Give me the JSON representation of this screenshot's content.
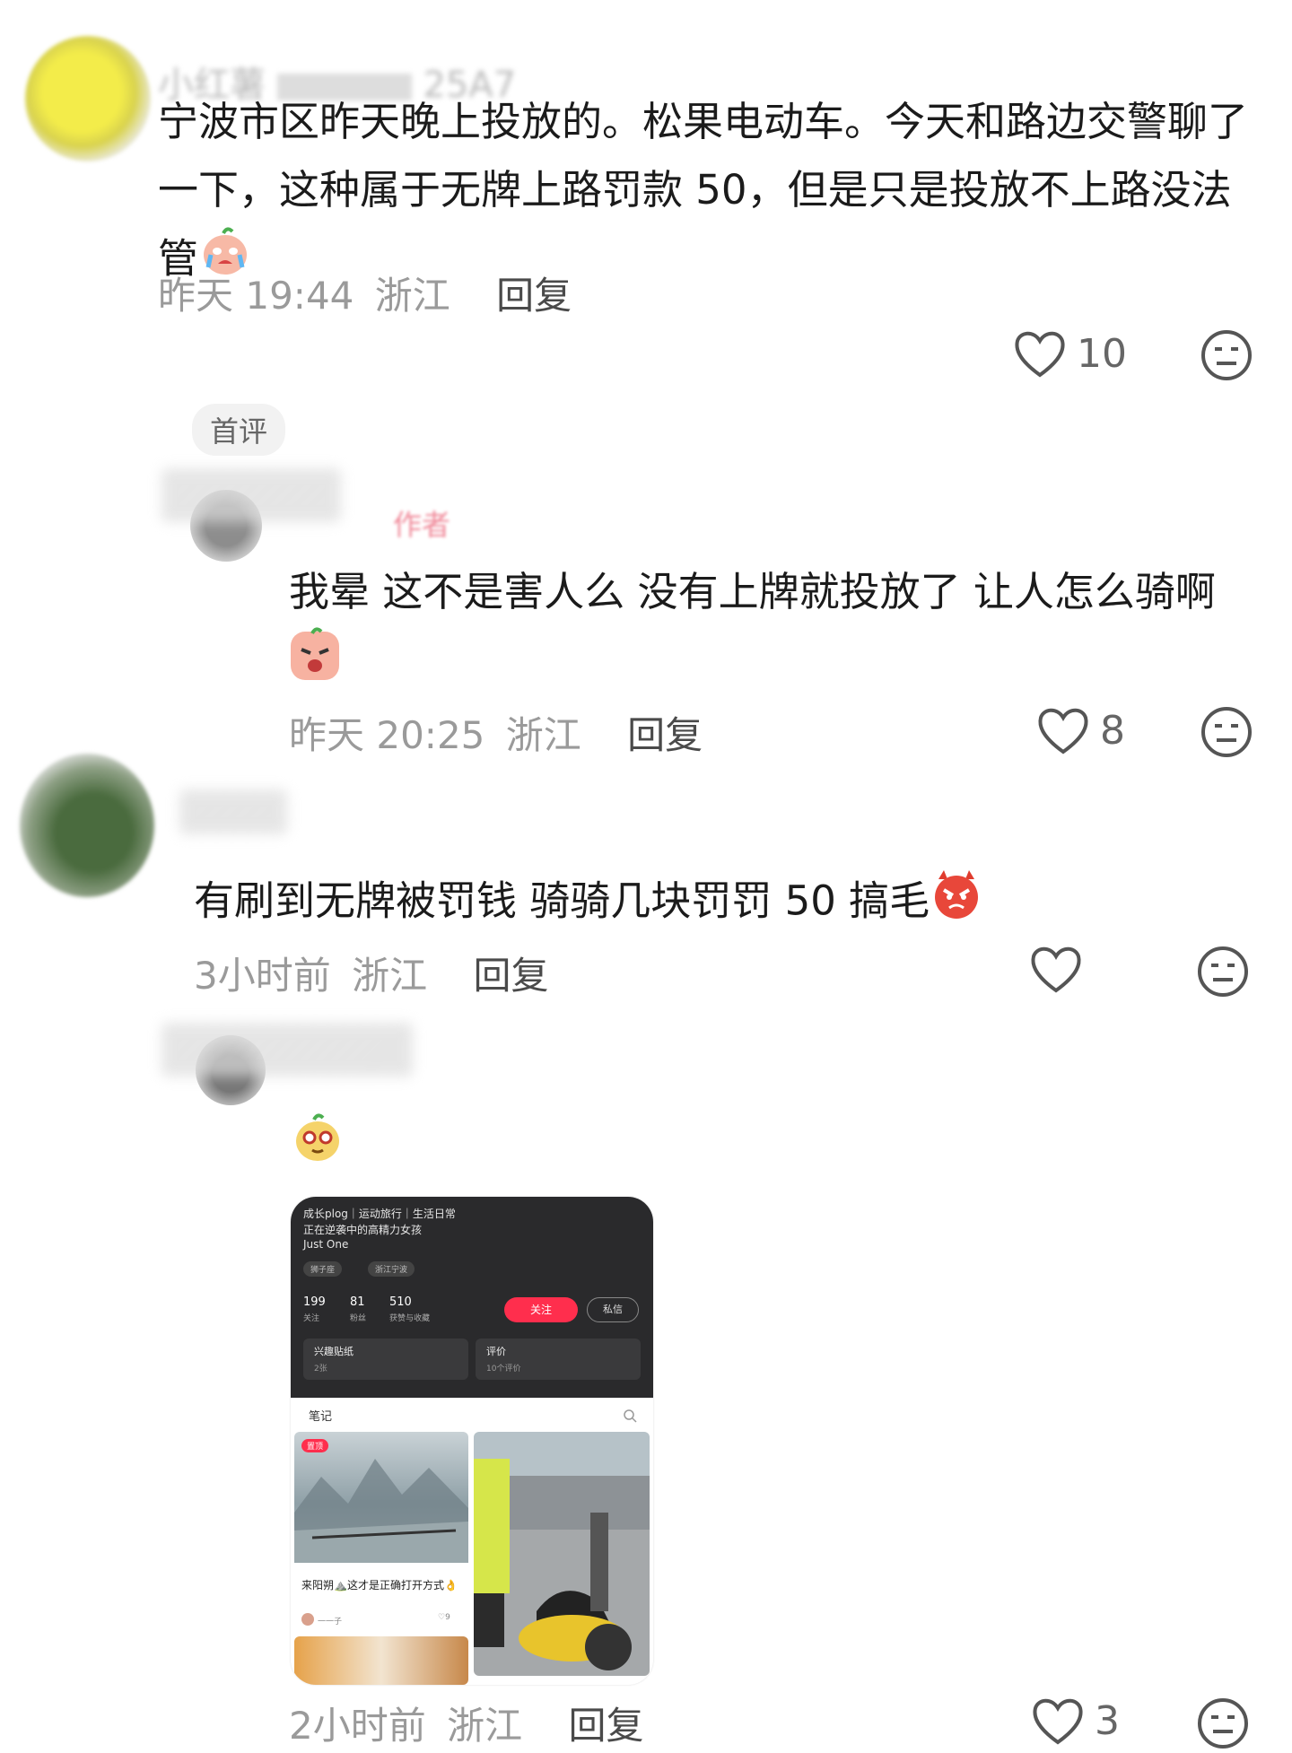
{
  "comments": [
    {
      "username": "小红薯",
      "username_suffix": "25A7",
      "body": "宁波市区昨天晚上投放的。松果电动车。今天和路边交警聊了一下，这种属于无牌上路罚款 50，但是只是投放不上路没法管",
      "time": "昨天 19:44",
      "location": "浙江",
      "reply_label": "回复",
      "likes": "10",
      "tag": "首评"
    },
    {
      "username": "",
      "author_tag": "作者",
      "body": "我晕 这不是害人么 没有上牌就投放了 让人怎么骑啊",
      "time": "昨天 20:25",
      "location": "浙江",
      "reply_label": "回复",
      "likes": "8"
    },
    {
      "username": "",
      "body": "有刷到无牌被罚钱 骑骑几块罚罚 50 搞毛",
      "time": "3小时前",
      "location": "浙江",
      "reply_label": "回复",
      "likes": ""
    },
    {
      "username": "",
      "time": "2小时前",
      "location": "浙江",
      "reply_label": "回复",
      "likes": "3"
    }
  ],
  "embedded_profile": {
    "bio_line1": "成长plog｜运动旅行｜生活日常",
    "bio_line2": "正在逆袭中的高精力女孩",
    "bio_line3": "Just One",
    "chips": [
      "狮子座",
      "浙江宁波"
    ],
    "stats": [
      {
        "num": "199",
        "label": "关注"
      },
      {
        "num": "81",
        "label": "粉丝"
      },
      {
        "num": "510",
        "label": "获赞与收藏"
      }
    ],
    "follow_label": "关注",
    "message_label": "私信",
    "card1_title": "兴趣贴纸",
    "card1_sub": "2张",
    "card2_title": "评价",
    "card2_sub": "10个评价",
    "notes_tab": "笔记",
    "pinned_badge": "置顶",
    "note1_title": "来阳朔⛰️这才是正确打开方式👌",
    "note1_author": "一一子",
    "note1_likes": "9"
  },
  "colors": {
    "accent_red": "#ff2e4d",
    "meta_gray": "#9a9a9a"
  }
}
